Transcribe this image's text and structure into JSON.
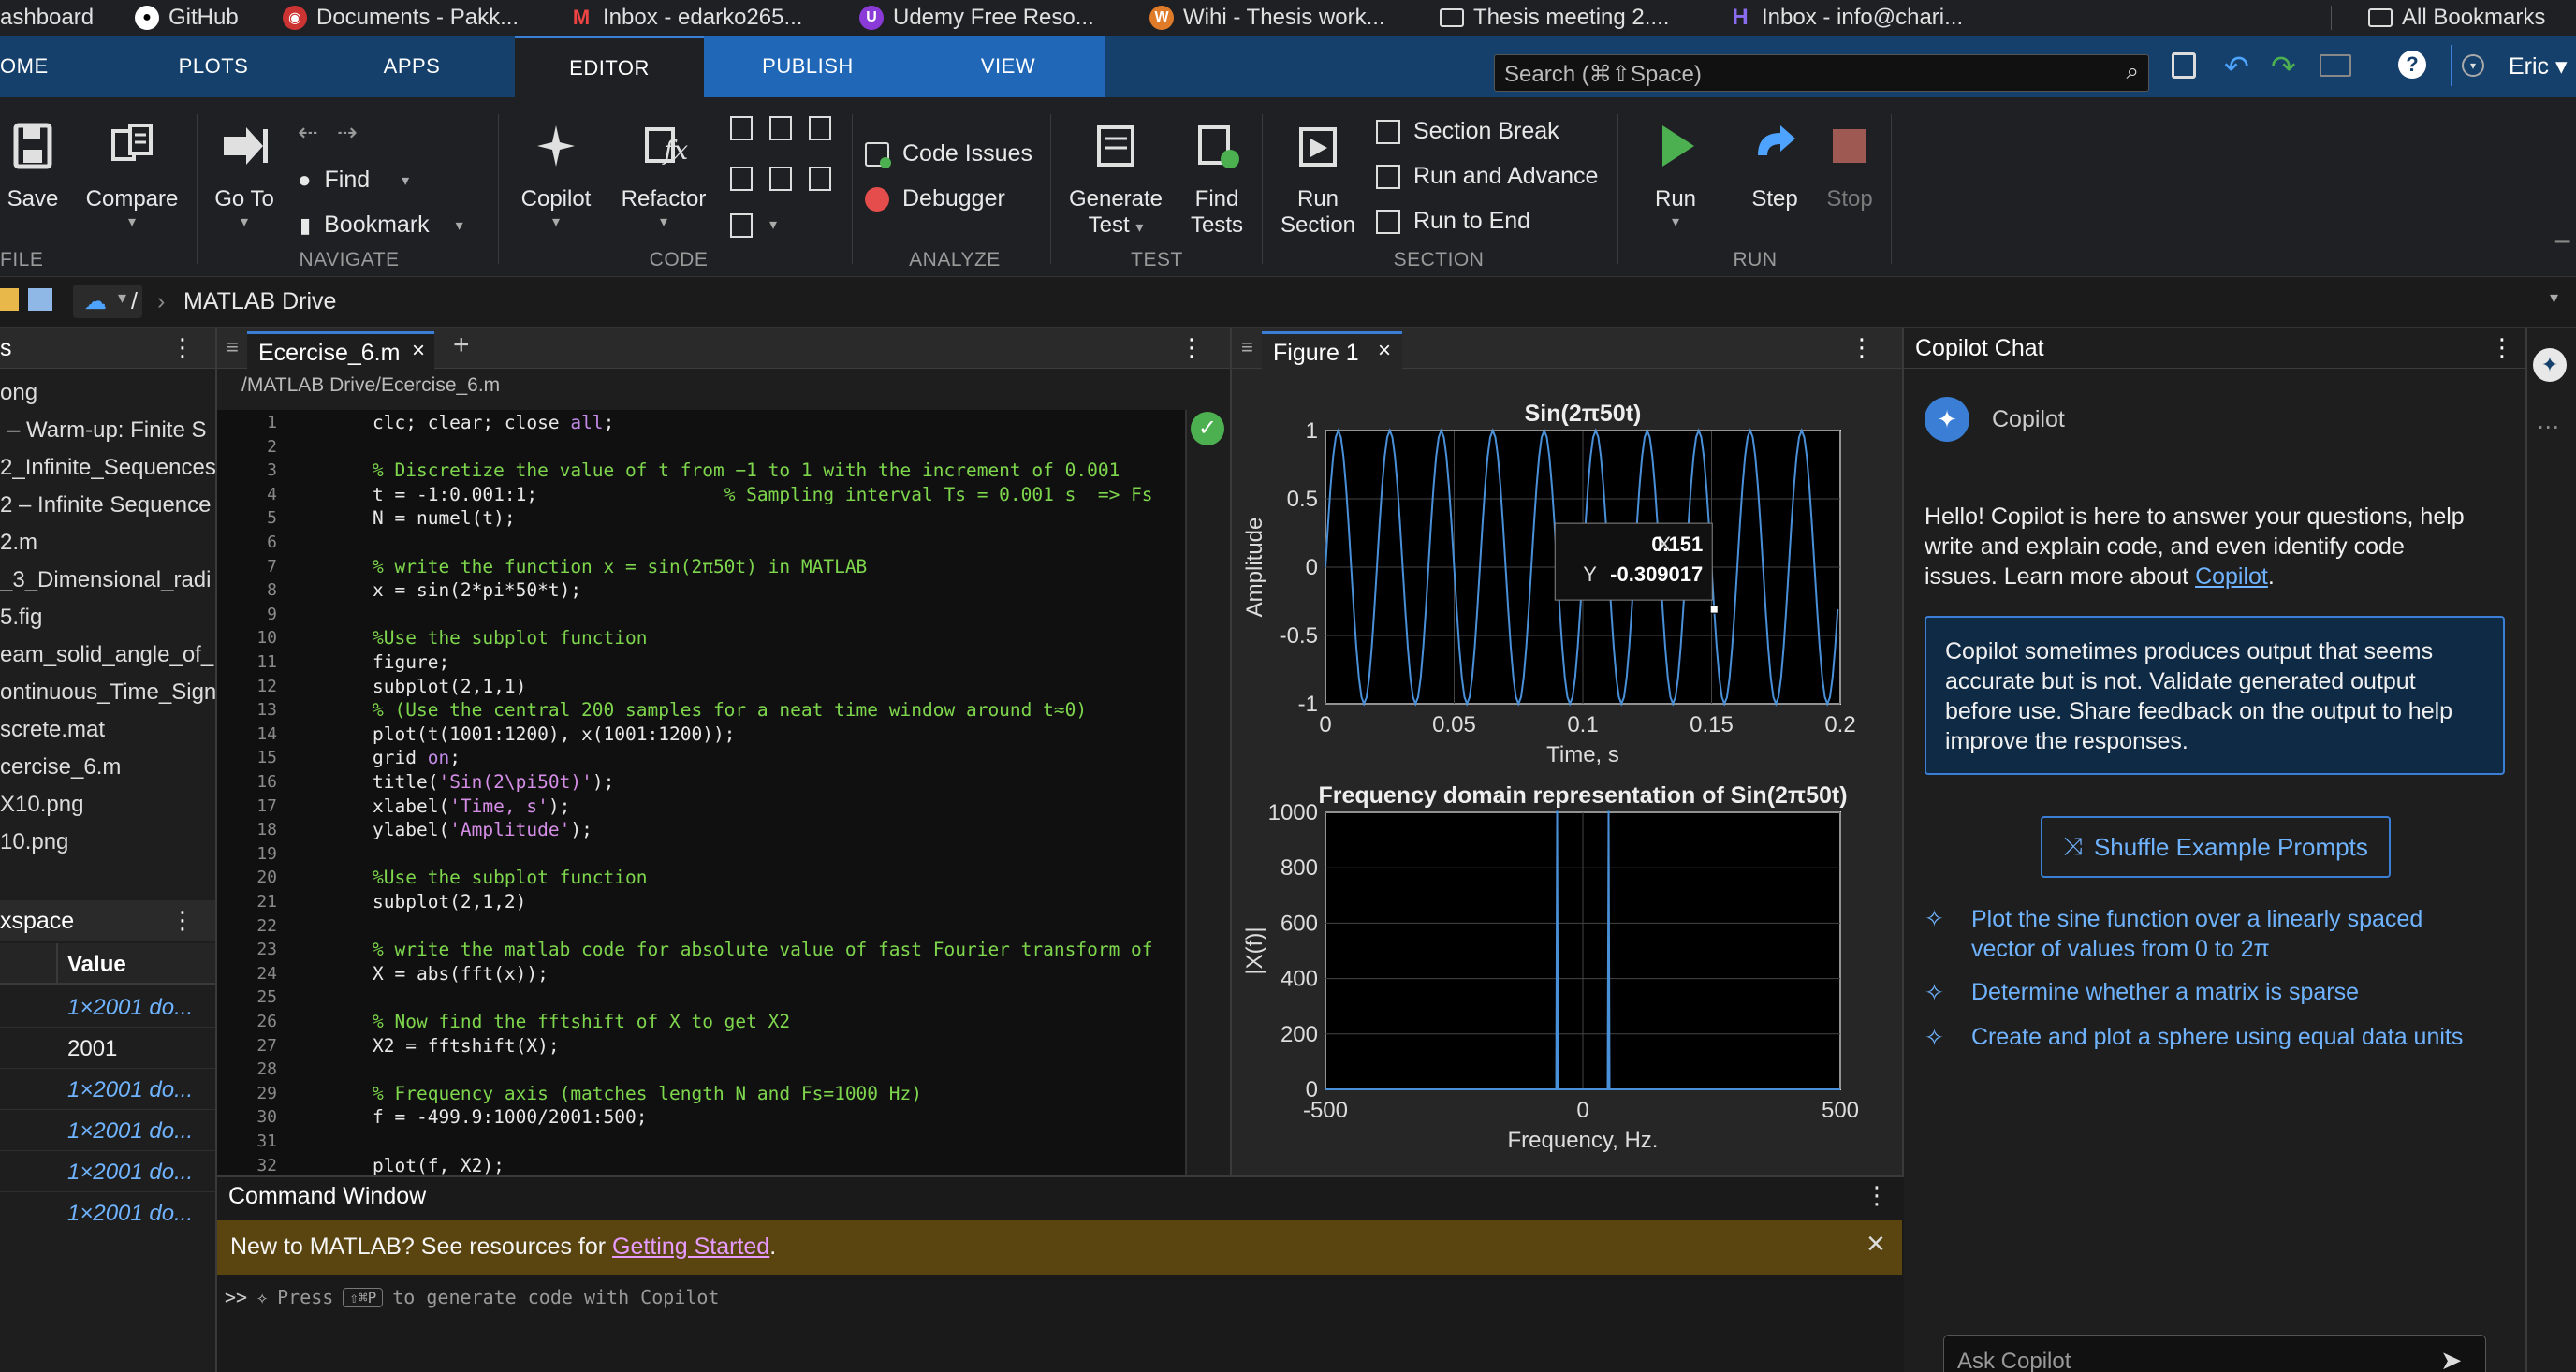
{
  "bookmarks": {
    "items": [
      "ashboard",
      "GitHub",
      "Documents - Pakk...",
      "Inbox - edarko265...",
      "Udemy Free Reso...",
      "Wihi - Thesis work...",
      "Thesis meeting 2....",
      "Inbox - info@chari..."
    ],
    "all": "All Bookmarks"
  },
  "ribbon_tabs": [
    "OME",
    "PLOTS",
    "APPS",
    "EDITOR",
    "PUBLISH",
    "VIEW"
  ],
  "search": {
    "placeholder": "Search (⌘⇧Space)"
  },
  "user": "Eric",
  "toolstrip": {
    "file": {
      "save": "Save",
      "compare": "Compare",
      "section": "FILE"
    },
    "navigate": {
      "goto_l1": "Go To",
      "find": "Find",
      "bookmark": "Bookmark",
      "section": "NAVIGATE"
    },
    "code": {
      "copilot": "Copilot",
      "refactor": "Refactor",
      "section": "CODE"
    },
    "analyze": {
      "code_issues": "Code Issues",
      "debugger": "Debugger",
      "section": "ANALYZE"
    },
    "test": {
      "generate_l1": "Generate",
      "generate_l2": "Test",
      "find_l1": "Find",
      "find_l2": "Tests",
      "section": "TEST"
    },
    "section": {
      "run_section_l1": "Run",
      "run_section_l2": "Section",
      "section_break": "Section Break",
      "run_advance": "Run and Advance",
      "run_end": "Run to End",
      "section": "SECTION"
    },
    "run": {
      "run": "Run",
      "step": "Step",
      "stop": "Stop",
      "section": "RUN"
    }
  },
  "address": {
    "root": "/",
    "path": "MATLAB Drive"
  },
  "file_browser": {
    "header": "s",
    "items": [
      "ong",
      "– Warm-up: Finite S",
      "2_Infinite_Sequences",
      "2 – Infinite Sequence",
      "2.m",
      "_3_Dimensional_radi",
      "5.fig",
      "eam_solid_angle_of_",
      "ontinuous_Time_Sign",
      "screte.mat",
      "cercise_6.m",
      "X10.png",
      "10.png"
    ]
  },
  "workspace": {
    "header": "xspace",
    "col_value": "Value",
    "rows": [
      "1×2001 do...",
      "2001",
      "1×2001 do...",
      "1×2001 do...",
      "1×2001 do...",
      "1×2001 do..."
    ]
  },
  "editor": {
    "tab": "Ecercise_6.m",
    "path": "/MATLAB Drive/Ecercise_6.m",
    "lines": [
      {
        "n": "1",
        "parts": [
          [
            "",
            "clc; clear; close "
          ],
          [
            "kw",
            "all"
          ],
          [
            "",
            ";"
          ]
        ]
      },
      {
        "n": "2",
        "parts": []
      },
      {
        "n": "3",
        "parts": [
          [
            "cm",
            "% Discretize the value of t from −1 to 1 with the increment of 0.001"
          ]
        ]
      },
      {
        "n": "4",
        "parts": [
          [
            "",
            "t = -1:0.001:1;                 "
          ],
          [
            "cm",
            "% Sampling interval Ts = 0.001 s  => Fs"
          ]
        ]
      },
      {
        "n": "5",
        "parts": [
          [
            "",
            "N = numel(t);"
          ]
        ]
      },
      {
        "n": "6",
        "parts": []
      },
      {
        "n": "7",
        "parts": [
          [
            "cm",
            "% write the function x = sin(2π50t) in MATLAB"
          ]
        ]
      },
      {
        "n": "8",
        "parts": [
          [
            "",
            "x = sin(2*pi*50*t);"
          ]
        ]
      },
      {
        "n": "9",
        "parts": []
      },
      {
        "n": "10",
        "parts": [
          [
            "cm",
            "%Use the subplot function"
          ]
        ]
      },
      {
        "n": "11",
        "parts": [
          [
            "",
            "figure;"
          ]
        ]
      },
      {
        "n": "12",
        "parts": [
          [
            "",
            "subplot(2,1,1)"
          ]
        ]
      },
      {
        "n": "13",
        "parts": [
          [
            "cm",
            "% (Use the central 200 samples for a neat time window around t≈0)"
          ]
        ]
      },
      {
        "n": "14",
        "parts": [
          [
            "",
            "plot(t(1001:1200), x(1001:1200));"
          ]
        ]
      },
      {
        "n": "15",
        "parts": [
          [
            "",
            "grid "
          ],
          [
            "kw",
            "on"
          ],
          [
            "",
            ";"
          ]
        ]
      },
      {
        "n": "16",
        "parts": [
          [
            "",
            "title("
          ],
          [
            "st",
            "'Sin(2\\pi50t)'"
          ],
          [
            "",
            ");"
          ]
        ]
      },
      {
        "n": "17",
        "parts": [
          [
            "",
            "xlabel("
          ],
          [
            "st",
            "'Time, s'"
          ],
          [
            "",
            ");"
          ]
        ]
      },
      {
        "n": "18",
        "parts": [
          [
            "",
            "ylabel("
          ],
          [
            "st",
            "'Amplitude'"
          ],
          [
            "",
            ");"
          ]
        ]
      },
      {
        "n": "19",
        "parts": []
      },
      {
        "n": "20",
        "parts": [
          [
            "cm",
            "%Use the subplot function"
          ]
        ]
      },
      {
        "n": "21",
        "parts": [
          [
            "",
            "subplot(2,1,2)"
          ]
        ]
      },
      {
        "n": "22",
        "parts": []
      },
      {
        "n": "23",
        "parts": [
          [
            "cm",
            "% write the matlab code for absolute value of fast Fourier transform of"
          ]
        ]
      },
      {
        "n": "24",
        "parts": [
          [
            "",
            "X = abs(fft(x));"
          ]
        ]
      },
      {
        "n": "25",
        "parts": []
      },
      {
        "n": "26",
        "parts": [
          [
            "cm",
            "% Now find the fftshift of X to get X2"
          ]
        ]
      },
      {
        "n": "27",
        "parts": [
          [
            "",
            "X2 = fftshift(X);"
          ]
        ]
      },
      {
        "n": "28",
        "parts": []
      },
      {
        "n": "29",
        "parts": [
          [
            "cm",
            "% Frequency axis (matches length N and Fs=1000 Hz)"
          ]
        ]
      },
      {
        "n": "30",
        "parts": [
          [
            "",
            "f = -499.9:1000/2001:500;"
          ]
        ]
      },
      {
        "n": "31",
        "parts": []
      },
      {
        "n": "32",
        "parts": [
          [
            "",
            "plot(f, X2);"
          ]
        ]
      }
    ]
  },
  "figure": {
    "tab": "Figure 1",
    "datatip": {
      "x_label": "X",
      "x_value": "0.151",
      "y_label": "Y",
      "y_value": "-0.309017"
    }
  },
  "chart_data": [
    {
      "type": "line",
      "title": "Sin(2π50t)",
      "xlabel": "Time, s",
      "ylabel": "Amplitude",
      "xlim": [
        0,
        0.2
      ],
      "ylim": [
        -1,
        1
      ],
      "xticks": [
        "0",
        "0.05",
        "0.1",
        "0.15",
        "0.2"
      ],
      "yticks": [
        "1",
        "0.5",
        "0",
        "-0.5",
        "-1"
      ],
      "grid": true,
      "series": [
        {
          "function": "sin(2*pi*50*t)",
          "t_start": 0,
          "t_end": 0.199,
          "t_step": 0.001
        }
      ],
      "datatip": {
        "x": 0.151,
        "y": -0.309017
      }
    },
    {
      "type": "line",
      "title": "Frequency domain representation of Sin(2π50t)",
      "xlabel": "Frequency, Hz.",
      "ylabel": "|X(f)|",
      "xlim": [
        -500,
        500
      ],
      "ylim": [
        0,
        1000
      ],
      "xticks": [
        "-500",
        "0",
        "500"
      ],
      "yticks": [
        "1000",
        "800",
        "600",
        "400",
        "200",
        "0"
      ],
      "grid": true,
      "series": [
        {
          "peaks": [
            {
              "f": -50,
              "value": 1000
            },
            {
              "f": 50,
              "value": 1000
            }
          ]
        }
      ]
    }
  ],
  "copilot": {
    "header": "Copilot Chat",
    "name": "Copilot",
    "intro_a": "Hello! Copilot is here to answer your questions, help",
    "intro_b": "write and explain code, and even identify code",
    "intro_c": "issues. Learn more about ",
    "intro_link": "Copilot",
    "warn_1": "Copilot sometimes produces output that seems",
    "warn_2": "accurate but is not. Validate generated output",
    "warn_3": "before use. Share feedback on the output to help",
    "warn_4": "improve the responses.",
    "shuffle": "Shuffle Example Prompts",
    "p1a": "Plot the sine function over a linearly spaced",
    "p1b": "vector of values from 0 to 2π",
    "p2": "Determine whether a matrix is sparse",
    "p3": "Create and plot a sphere using equal data units",
    "ask_placeholder": "Ask Copilot"
  },
  "command_window": {
    "title": "Command Window",
    "banner_text": "New to MATLAB? See resources for ",
    "banner_link": "Getting Started",
    "banner_end": ".",
    "prompt": ">>",
    "hint_a": "Press",
    "hint_key": "⇧⌘P",
    "hint_b": "to generate code with Copilot"
  },
  "colors": {
    "accent": "#2067b8",
    "ribbon": "#15406b",
    "comment": "#7ed64d",
    "keyword": "#c08ae6",
    "plot_line": "#4a90d9"
  }
}
